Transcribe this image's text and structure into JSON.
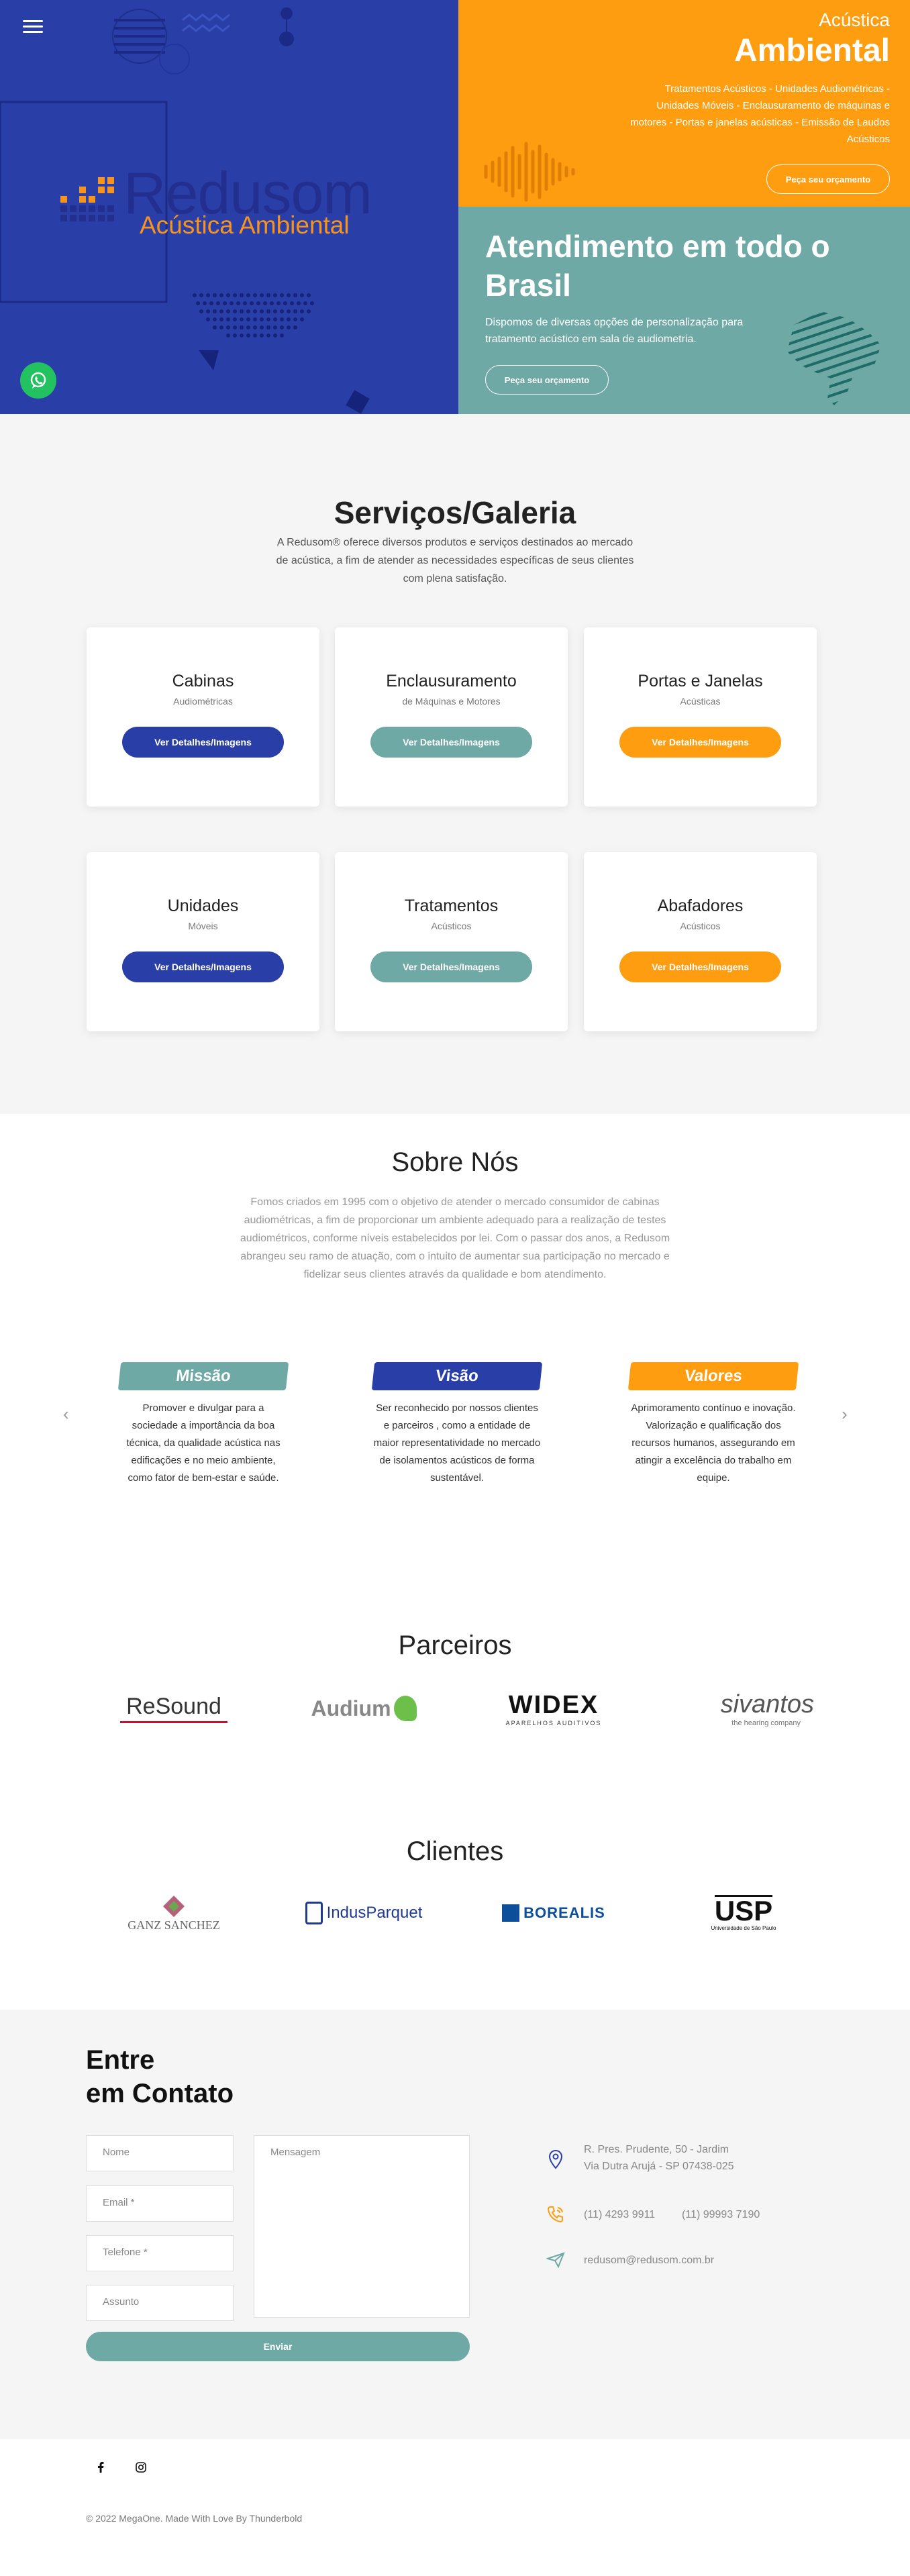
{
  "hero": {
    "logo": {
      "word": "Redusom",
      "sub": "Acústica Ambiental"
    },
    "right_top": {
      "title_light": "Acústica",
      "title_bold": "Ambiental",
      "text": "Tratamentos Acústicos - Unidades Audiométricas - Unidades Móveis - Enclausuramento de máquinas e motores - Portas e janelas acústicas - Emissão de Laudos Acústicos",
      "button": "Peça seu orçamento"
    },
    "right_bottom": {
      "title": "Atendimento em todo o Brasil",
      "text": "Dispomos de diversas opções de personalização para tratamento acústico em sala de audiometria.",
      "button": "Peça seu orçamento"
    },
    "colors": {
      "blue": "#2a3ea8",
      "orange": "#ff9d10",
      "teal": "#6fa9a5"
    }
  },
  "services": {
    "title": "Serviços/Galeria",
    "description": "A Redusom® oferece diversos produtos e serviços destinados ao mercado de acústica, a fim de atender as necessidades específicas de seus clientes com plena satisfação.",
    "cards": [
      {
        "title": "Cabinas",
        "subtitle": "Audiométricas",
        "button": "Ver Detalhes/Imagens",
        "color": "#2a3ea8"
      },
      {
        "title": "Enclausuramento",
        "subtitle": "de Máquinas e Motores",
        "button": "Ver Detalhes/Imagens",
        "color": "#6fa9a5"
      },
      {
        "title": "Portas e Janelas",
        "subtitle": "Acústicas",
        "button": "Ver Detalhes/Imagens",
        "color": "#ff9d10"
      },
      {
        "title": "Unidades",
        "subtitle": "Móveis",
        "button": "Ver Detalhes/Imagens",
        "color": "#2a3ea8"
      },
      {
        "title": "Tratamentos",
        "subtitle": "Acústicos",
        "button": "Ver Detalhes/Imagens",
        "color": "#6fa9a5"
      },
      {
        "title": "Abafadores",
        "subtitle": "Acústicos",
        "button": "Ver Detalhes/Imagens",
        "color": "#ff9d10"
      }
    ]
  },
  "about": {
    "title": "Sobre Nós",
    "description": "Fomos criados em 1995 com o objetivo de atender o mercado consumidor de cabinas audiométricas, a fim de proporcionar um ambiente adequado para a realização de testes audiométricos, conforme níveis estabelecidos por lei. Com o passar dos anos, a Redusom abrangeu seu ramo de atuação, com o intuito de aumentar sua participação no mercado e fidelizar seus clientes através da qualidade e bom atendimento.",
    "items": [
      {
        "title": "Missão",
        "text": "Promover e divulgar para a sociedade a importância da boa técnica, da qualidade acústica nas edificações e no meio ambiente, como fator de bem-estar e saúde.",
        "color": "#6fa9a5"
      },
      {
        "title": "Visão",
        "text": "Ser reconhecido por nossos clientes e parceiros , como a entidade de maior representatividade no mercado de isolamentos acústicos de forma sustentável.",
        "color": "#2a3ea8"
      },
      {
        "title": "Valores",
        "text": "Aprimoramento contínuo e inovação. Valorização e qualificação dos recursos humanos, assegurando em atingir a excelência do trabalho em equipe.",
        "color": "#ff9d10"
      }
    ],
    "prev": "‹",
    "next": "›"
  },
  "partners": {
    "title": "Parceiros",
    "logos": [
      {
        "name": "ReSound"
      },
      {
        "name": "Audium"
      },
      {
        "name": "WIDEX",
        "tagline": "APARELHOS AUDITIVOS"
      },
      {
        "name": "sivantos",
        "tagline": "the hearing company"
      }
    ]
  },
  "clients": {
    "title": "Clientes",
    "logos": [
      {
        "name": "GANZ SANCHEZ"
      },
      {
        "name": "IndusParquet"
      },
      {
        "name": "BOREALIS"
      },
      {
        "name": "USP",
        "tagline": "Universidade de São Paulo"
      }
    ]
  },
  "contact": {
    "title_line1": "Entre",
    "title_line2": "em Contato",
    "fields": {
      "name": "Nome",
      "email": "Email *",
      "phone": "Telefone *",
      "subject": "Assunto",
      "message": "Mensagem"
    },
    "send": "Enviar",
    "address": "R. Pres. Prudente, 50 - Jardim Via Dutra Arujá - SP 07438-025",
    "phone1": "(11) 4293 9911",
    "phone2": "(11) 99993 7190",
    "email": "redusom@redusom.com.br"
  },
  "footer": {
    "copyright": "© 2022 MegaOne. Made With Love By Thunderbold",
    "social": [
      "facebook-icon",
      "instagram-icon"
    ]
  }
}
